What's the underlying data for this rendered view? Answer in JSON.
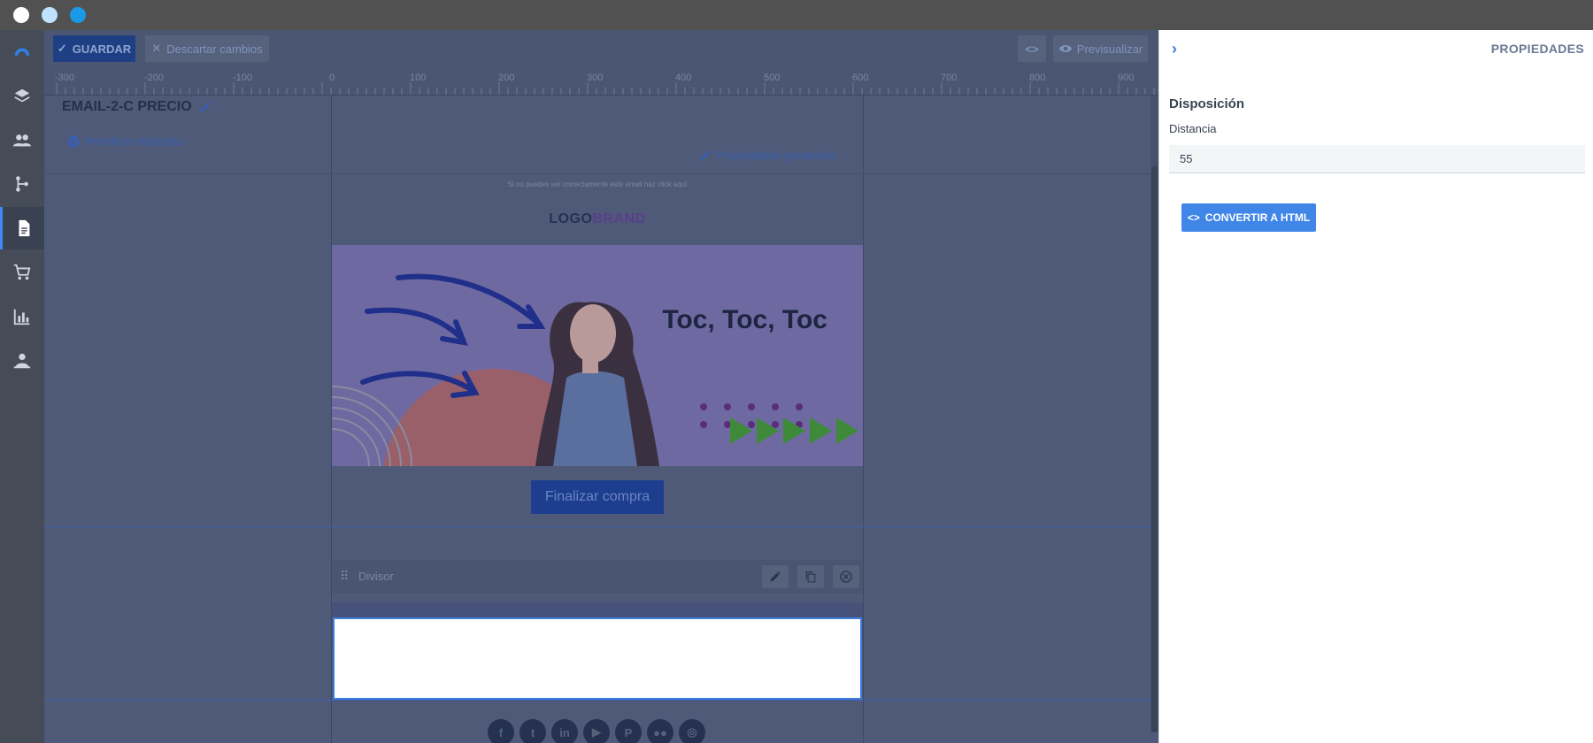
{
  "window": {
    "dot_colors": [
      "#ffffff",
      "#bfe3ff",
      "#1a9ae6"
    ]
  },
  "nav": {
    "items": [
      {
        "icon": "brand-logo-icon"
      },
      {
        "icon": "layers-icon"
      },
      {
        "icon": "people-icon"
      },
      {
        "icon": "flow-icon"
      },
      {
        "icon": "document-icon",
        "active": true
      },
      {
        "icon": "cart-icon"
      },
      {
        "icon": "bar-chart-icon"
      },
      {
        "icon": "support-agent-icon"
      }
    ]
  },
  "toolbar": {
    "save_label": "GUARDAR",
    "discard_label": "Descartar cambios",
    "code_label": "<>",
    "preview_label": "Previsualizar"
  },
  "ruler": {
    "ticks": [
      "-300",
      "-200",
      "-100",
      "0",
      "100",
      "200",
      "300",
      "400",
      "500",
      "600",
      "700",
      "800",
      "900"
    ]
  },
  "editor": {
    "title": "EMAIL-2-C PRECIO",
    "tags_label": "Introduce etiquetas",
    "general_props_label": "Propiedades generales",
    "cant_see_text": "Si no puedes ver correctamente este email haz click aquí",
    "logo_part1": "LOGO",
    "logo_part2": "BRAND",
    "banner_title": "Toc, Toc, Toc",
    "finish_button": "Finalizar compra",
    "divisor_label": "Divisor",
    "socials": [
      "f",
      "t",
      "in",
      "▶",
      "P",
      "●●",
      "◎"
    ]
  },
  "panel": {
    "title": "PROPIEDADES",
    "section": "Disposición",
    "distance_label": "Distancia",
    "distance_value": "55",
    "convert_label": "CONVERTIR A HTML"
  },
  "colors": {
    "accent": "#3f86e8",
    "overlay": "#4c5976"
  }
}
